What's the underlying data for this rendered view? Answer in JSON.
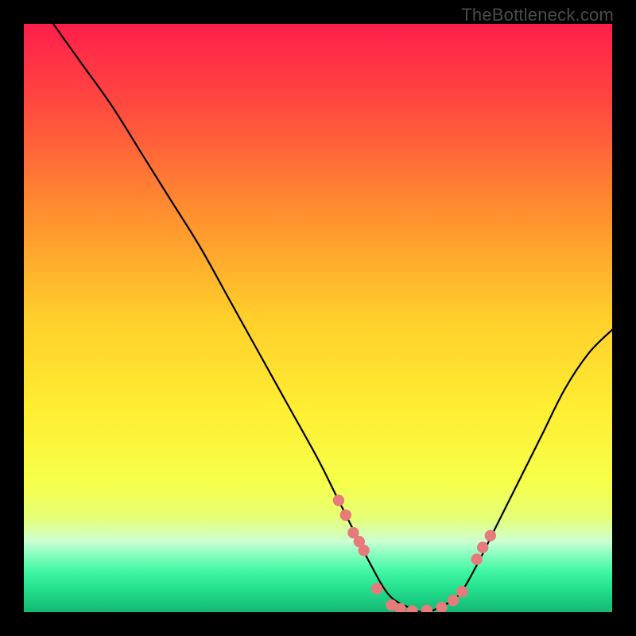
{
  "watermark": "TheBottleneck.com",
  "colors": {
    "frame": "#000000",
    "curve": "#000000",
    "dot_fill": "#e77b7b",
    "dot_stroke": "#d76464"
  },
  "chart_data": {
    "type": "line",
    "title": "",
    "xlabel": "",
    "ylabel": "",
    "xlim": [
      0,
      100
    ],
    "ylim": [
      0,
      100
    ],
    "note": "Bottleneck-style curve. y ≈ mismatch %. x ≈ relative performance. Minimum ≈ 0 near x 62–72. Values estimated from gradient bands (red≈100, green≈0).",
    "series": [
      {
        "name": "bottleneck-curve",
        "x": [
          5,
          10,
          15,
          20,
          25,
          30,
          35,
          40,
          45,
          50,
          53,
          56,
          59,
          62,
          65,
          68,
          71,
          74,
          77,
          80,
          84,
          88,
          92,
          96,
          100
        ],
        "y": [
          100,
          93,
          86,
          78,
          70,
          62,
          53,
          44,
          35,
          26,
          20,
          14,
          8,
          3,
          1,
          0,
          1,
          3,
          8,
          14,
          22,
          30,
          38,
          44,
          48
        ]
      }
    ],
    "dots": {
      "name": "highlight-points",
      "comment": "Salmon dots clustered near the trough and partway up each side.",
      "x": [
        53.5,
        54.7,
        56.0,
        57.0,
        57.8,
        60.0,
        62.5,
        64.0,
        66.0,
        68.5,
        71.0,
        73.0,
        74.5,
        77.0,
        78.0,
        79.3
      ],
      "y": [
        19.0,
        16.5,
        13.5,
        12.0,
        10.5,
        4.0,
        1.2,
        0.6,
        0.2,
        0.3,
        0.8,
        2.0,
        3.5,
        9.0,
        11.0,
        13.0
      ]
    },
    "gradient_stops": [
      {
        "pct": 0,
        "color": "#ff1f4b"
      },
      {
        "pct": 14,
        "color": "#ff4a3f"
      },
      {
        "pct": 32,
        "color": "#ff8f2f"
      },
      {
        "pct": 50,
        "color": "#ffcf2b"
      },
      {
        "pct": 66,
        "color": "#ffef33"
      },
      {
        "pct": 78,
        "color": "#f6ff4a"
      },
      {
        "pct": 84,
        "color": "#e6ff77"
      },
      {
        "pct": 88,
        "color": "#ccffd4"
      },
      {
        "pct": 90,
        "color": "#8dffc1"
      },
      {
        "pct": 93,
        "color": "#42f7a4"
      },
      {
        "pct": 96,
        "color": "#24e08e"
      },
      {
        "pct": 100,
        "color": "#14b873"
      }
    ]
  }
}
